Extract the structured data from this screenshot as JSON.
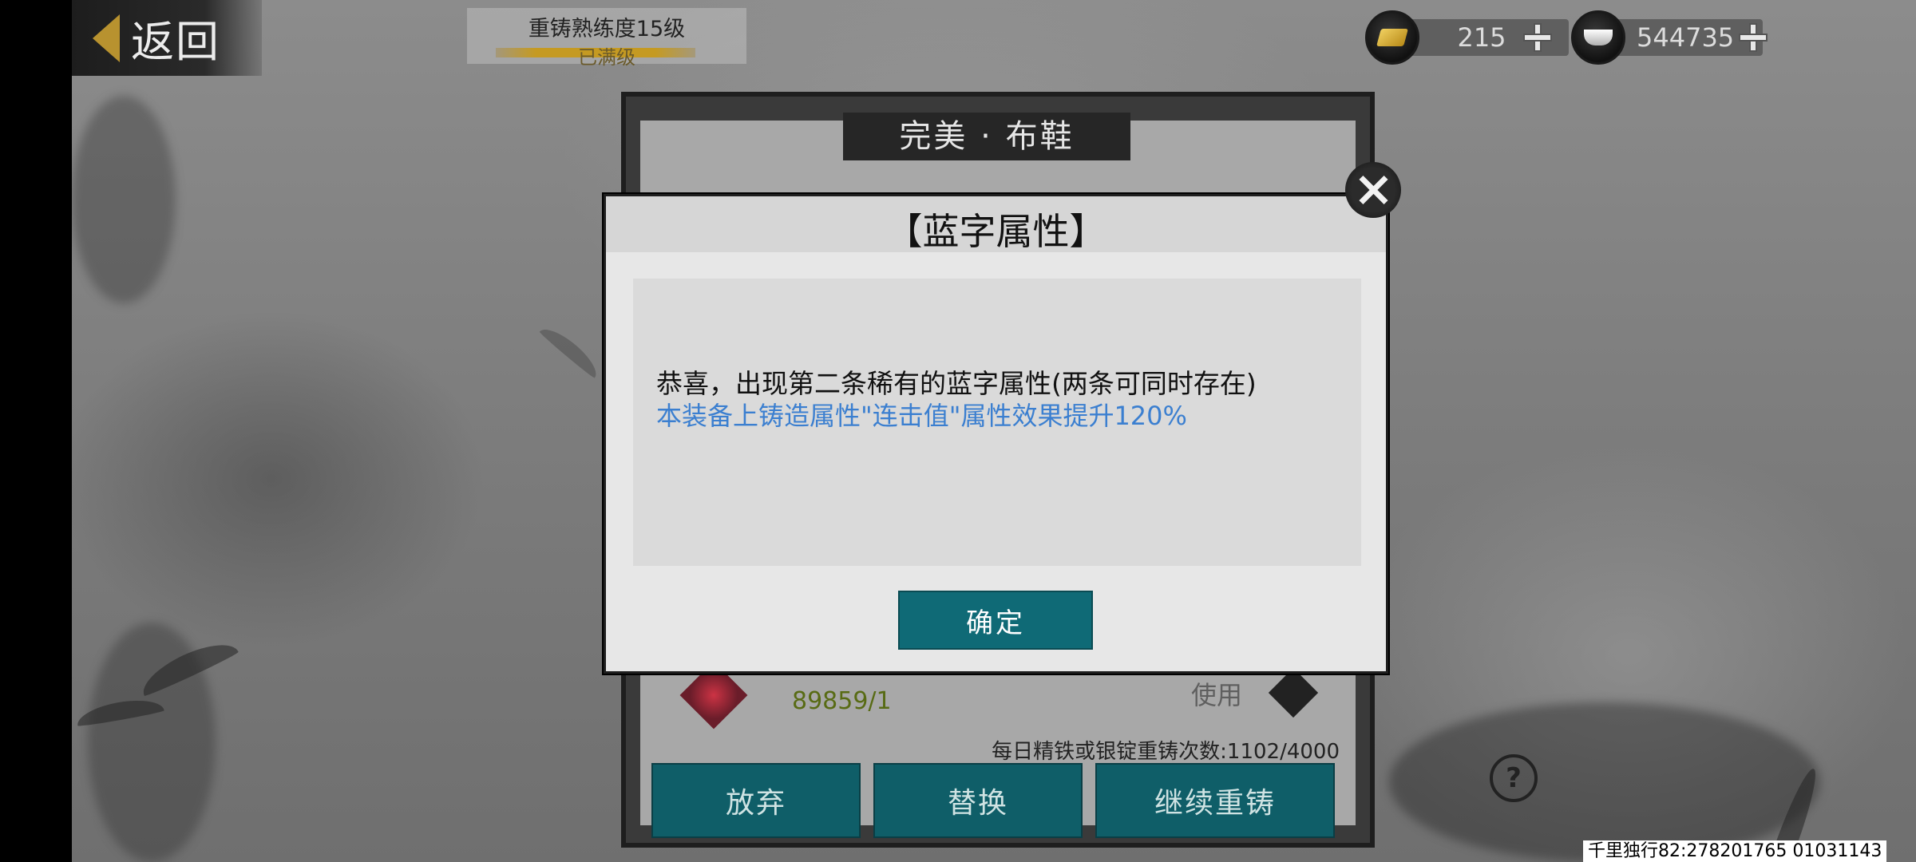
{
  "header": {
    "back_label": "返回",
    "proficiency_title": "重铸熟练度15级",
    "proficiency_status": "已满级"
  },
  "currency": {
    "gold": "215",
    "silver": "544735",
    "gold_icon": "gold-ingot-icon",
    "silver_icon": "silver-ingot-icon"
  },
  "panel": {
    "title": "完美 · 布鞋",
    "value": "89859/1",
    "use_label": "使用",
    "daily_count": "每日精铁或银锭重铸次数:1102/4000",
    "buttons": {
      "abandon": "放弃",
      "replace": "替换",
      "continue": "继续重铸"
    }
  },
  "dialog": {
    "title": "【蓝字属性】",
    "message_line1": "恭喜，出现第二条稀有的蓝字属性(两条可同时存在)",
    "message_line2": "本装备上铸造属性\"连击值\"属性效果提升120%",
    "confirm_label": "确定",
    "message_line2_color": "#3b7fd0"
  },
  "footer": {
    "help_label": "?",
    "watermark": "千里独行82:278201765 01031143"
  }
}
